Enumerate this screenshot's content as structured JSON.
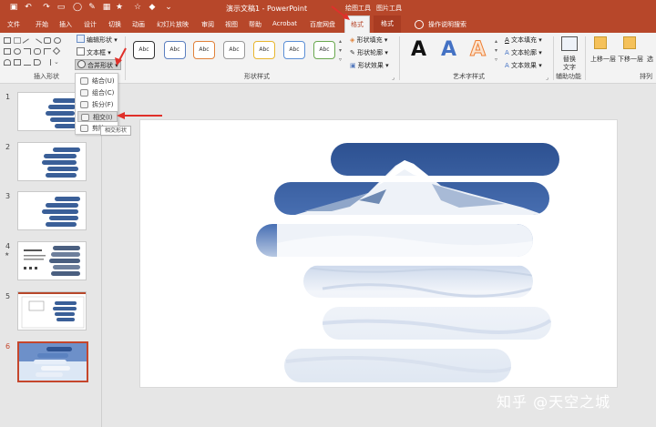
{
  "window": {
    "doc_title": "演示文稿1 - PowerPoint",
    "context_group_drawing": "绘图工具",
    "context_group_picture": "图片工具"
  },
  "tabs": [
    {
      "label": "文件"
    },
    {
      "label": "开始"
    },
    {
      "label": "插入"
    },
    {
      "label": "设计"
    },
    {
      "label": "切换"
    },
    {
      "label": "动画"
    },
    {
      "label": "幻灯片放映"
    },
    {
      "label": "审阅"
    },
    {
      "label": "视图"
    },
    {
      "label": "帮助"
    },
    {
      "label": "Acrobat"
    },
    {
      "label": "百度网盘"
    },
    {
      "label": "格式"
    },
    {
      "label": "格式"
    }
  ],
  "tell_me": "操作说明搜索",
  "ribbon": {
    "insert_shapes": {
      "label": "插入形状",
      "edit_shape": "编辑形状",
      "text_box": "文本框",
      "merge_shapes": "合并形状"
    },
    "shape_styles": {
      "label": "形状样式",
      "presets": [
        "Abc",
        "Abc",
        "Abc",
        "Abc",
        "Abc",
        "Abc",
        "Abc"
      ],
      "preset_colors": [
        "#333333",
        "#5b7fbf",
        "#e0823a",
        "#999999",
        "#e8b62f",
        "#5b8fd6",
        "#6aa84f"
      ],
      "fill": "形状填充",
      "outline": "形状轮廓",
      "effects": "形状效果"
    },
    "wordart_styles": {
      "label": "艺术字样式",
      "letters": [
        "A",
        "A",
        "A"
      ],
      "letter_colors": [
        "#111111",
        "#4472c4",
        "#ed7d31"
      ],
      "text_fill": "文本填充",
      "text_outline": "文本轮廓",
      "text_effects": "文本效果"
    },
    "accessibility": {
      "label": "辅助功能",
      "alt_text_line1": "替换",
      "alt_text_line2": "文字"
    },
    "arrange": {
      "label": "排列",
      "bring_forward": "上移一层",
      "send_backward": "下移一层",
      "selection_pane": "选"
    }
  },
  "merge_menu": {
    "items": [
      {
        "label": "结合(U)"
      },
      {
        "label": "组合(C)"
      },
      {
        "label": "拆分(F)"
      },
      {
        "label": "相交(I)"
      },
      {
        "label": "剪除"
      }
    ],
    "tooltip": "相交形状"
  },
  "slides": {
    "numbers": [
      "1",
      "2",
      "3",
      "4",
      "5",
      "6"
    ],
    "selected": "6"
  },
  "watermark": "知乎 @天空之城",
  "colors": {
    "accent": "#b7472a",
    "pill_blue": "#3a5f98",
    "arrow_red": "#e0302a"
  }
}
